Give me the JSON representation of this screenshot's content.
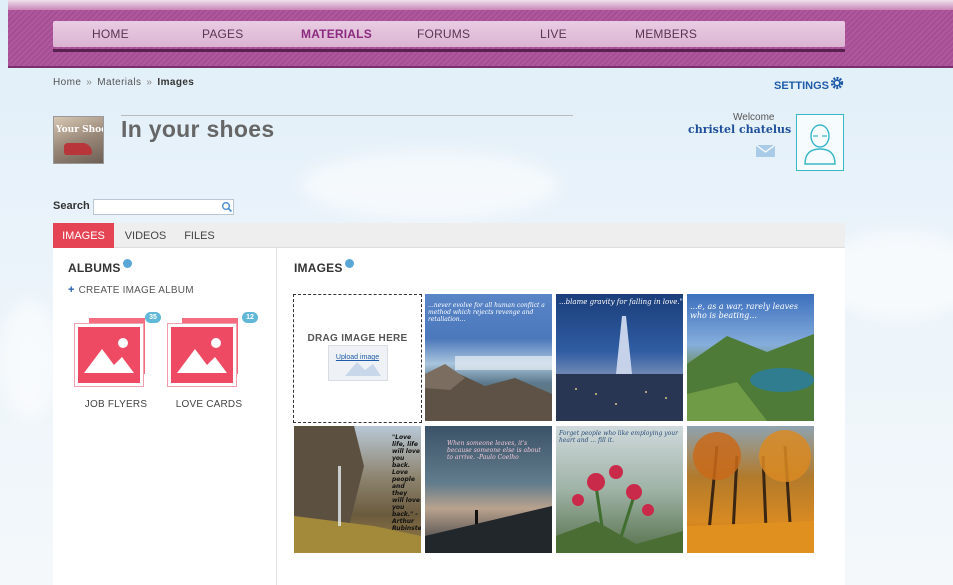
{
  "nav": {
    "items": [
      {
        "label": "HOME"
      },
      {
        "label": "PAGES"
      },
      {
        "label": "MATERIALS"
      },
      {
        "label": "FORUMS"
      },
      {
        "label": "LIVE"
      },
      {
        "label": "MEMBERS"
      }
    ],
    "active": "MATERIALS"
  },
  "breadcrumb": {
    "home": "Home",
    "materials": "Materials",
    "current": "Images",
    "separator": "»"
  },
  "settings": {
    "label": "SETTINGS"
  },
  "group": {
    "title": "In your shoes",
    "logo_text": "Your Shoes"
  },
  "user": {
    "welcome": "Welcome",
    "name": "christel chatelus"
  },
  "search": {
    "label": "Search",
    "value": ""
  },
  "tabs": [
    {
      "label": "IMAGES"
    },
    {
      "label": "VIDEOS"
    },
    {
      "label": "FILES"
    }
  ],
  "albums": {
    "heading": "ALBUMS",
    "create_label": "CREATE IMAGE ALBUM",
    "items": [
      {
        "label": "JOB FLYERS",
        "count": "35"
      },
      {
        "label": "LOVE CARDS",
        "count": "12"
      }
    ]
  },
  "images": {
    "heading": "IMAGES",
    "drop_text": "DRAG IMAGE HERE",
    "upload_label": "Upload image",
    "thumbnails": [
      {
        "caption": "...never evolve for all human conflict a method which rejects revenge and retaliation..."
      },
      {
        "caption": "...blame gravity for falling in love.\""
      },
      {
        "caption": "...e, as a war, rarely leaves who is beating..."
      },
      {
        "caption": "\"Love life, life will love you back. Love people and they will love you back.\" -Arthur Rubinstein"
      },
      {
        "caption": "When someone leaves, it's because someone else is about to arrive. -Paulo Coelho"
      },
      {
        "caption": "Forget people who like employing your heart and ... fill it."
      },
      {
        "caption": ""
      }
    ]
  },
  "colors": {
    "brand_purple": "#a44e93",
    "active_tab": "#e54454",
    "album_pink": "#ee4a64",
    "link_blue": "#1f5ba8",
    "badge_blue": "#61b7d8"
  }
}
